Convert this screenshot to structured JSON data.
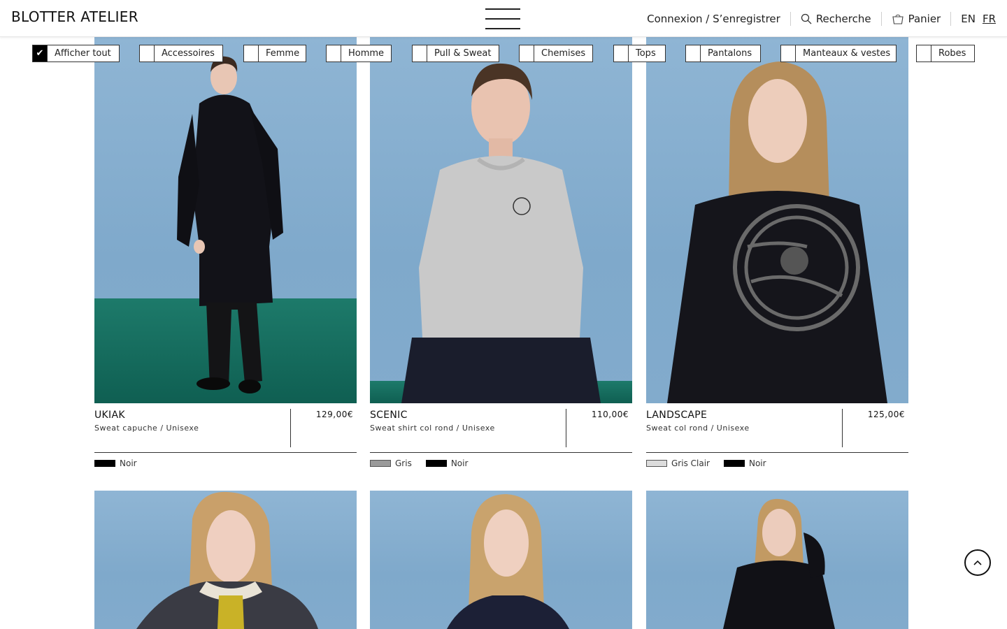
{
  "header": {
    "logo": "BLOTTER ATELIER",
    "login": "Connexion / S’enregistrer",
    "search": "Recherche",
    "cart": "Panier",
    "lang_en": "EN",
    "lang_fr": "FR",
    "active_lang": "FR"
  },
  "filters": [
    {
      "label": "Afficher tout",
      "checked": true
    },
    {
      "label": "Accessoires",
      "checked": false
    },
    {
      "label": "Femme",
      "checked": false
    },
    {
      "label": "Homme",
      "checked": false
    },
    {
      "label": "Pull & Sweat",
      "checked": false
    },
    {
      "label": "Chemises",
      "checked": false
    },
    {
      "label": "Tops",
      "checked": false
    },
    {
      "label": "Pantalons",
      "checked": false
    },
    {
      "label": "Manteaux & vestes",
      "checked": false
    },
    {
      "label": "Robes",
      "checked": false
    }
  ],
  "products": [
    {
      "name": "UKIAK",
      "subtitle": "Sweat capuche / Unisexe",
      "price": "129,00€",
      "colors": [
        {
          "name": "Noir",
          "hex": "#000000"
        }
      ]
    },
    {
      "name": "SCENIC",
      "subtitle": "Sweat shirt col rond / Unisexe",
      "price": "110,00€",
      "colors": [
        {
          "name": "Gris",
          "hex": "#9a9a9a"
        },
        {
          "name": "Noir",
          "hex": "#000000"
        }
      ]
    },
    {
      "name": "LANDSCAPE",
      "subtitle": "Sweat col rond / Unisexe",
      "price": "125,00€",
      "colors": [
        {
          "name": "Gris Clair",
          "hex": "#dcdcdc"
        },
        {
          "name": "Noir",
          "hex": "#000000"
        }
      ]
    }
  ],
  "colors": {
    "accent": "#000000",
    "photo_bg": "#8fb5d4",
    "floor": "#1d7a6a"
  }
}
